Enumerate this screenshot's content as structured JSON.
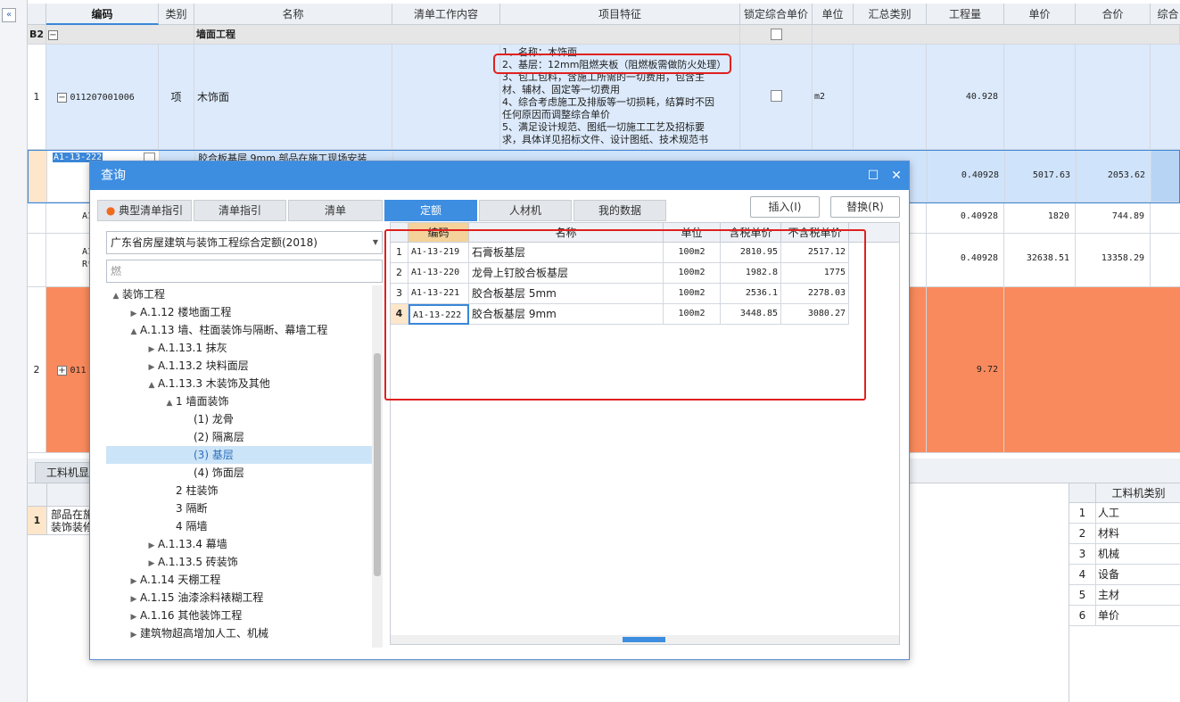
{
  "columns": [
    "编码",
    "类别",
    "名称",
    "清单工作内容",
    "项目特征",
    "锁定综合单价",
    "单位",
    "汇总类别",
    "工程量",
    "单价",
    "合价",
    "综合"
  ],
  "group": {
    "label": "B2",
    "name": "墙面工程"
  },
  "rows": [
    {
      "idx": "1",
      "code": "011207001006",
      "type": "项",
      "name": "木饰面",
      "unit": "m2",
      "qty": "40.928",
      "features": [
        "1、名称：木饰面",
        "2、基层：12mm阻燃夹板（阻燃板需做防火处理）",
        "3、包工包料，含施工所需的一切费用，包含主",
        "材、辅材、固定等一切费用",
        "4、综合考虑施工及排版等一切损耗，结算时不因",
        "任何原因而调整综合单价",
        "5、满足设计规范、图纸一切施工工艺及招标要",
        "求，具体详见招标文件、设计图纸、技术规范书"
      ]
    },
    {
      "idx": "",
      "code": "A1-13-222",
      "name": "胶合板基层 9mm  部品在施工现场安装",
      "qty": "0.40928",
      "price": "5017.63",
      "total": "2053.62"
    },
    {
      "idx": "",
      "code": "A1",
      "qty": "0.40928",
      "price": "1820",
      "total": "744.89"
    },
    {
      "idx": "",
      "code": "A1",
      "code2": "R*",
      "qty": "0.40928",
      "price": "32638.51",
      "total": "13358.29"
    },
    {
      "idx": "2",
      "code": "011",
      "qty": "9.72"
    }
  ],
  "bottom": {
    "tab": "工料机显",
    "row_idx": "1",
    "row_text1": "部品在施",
    "row_text2": "装饰装修",
    "category_header": "工料机类别",
    "categories": [
      {
        "n": "1",
        "v": "人工"
      },
      {
        "n": "2",
        "v": "材料"
      },
      {
        "n": "3",
        "v": "机械"
      },
      {
        "n": "4",
        "v": "设备"
      },
      {
        "n": "5",
        "v": "主材"
      },
      {
        "n": "6",
        "v": "单价"
      }
    ]
  },
  "dialog": {
    "title": "查询",
    "tabs": [
      "典型清单指引",
      "清单指引",
      "清单",
      "定额",
      "人材机",
      "我的数据"
    ],
    "insert_btn": "插入(I)",
    "replace_btn": "替换(R)",
    "library": "广东省房屋建筑与装饰工程综合定额(2018)",
    "search": "燃",
    "tree": [
      {
        "t": "装饰工程",
        "lvl": 0,
        "arr": "▲"
      },
      {
        "t": "A.1.12 楼地面工程",
        "lvl": 1,
        "arr": "▶"
      },
      {
        "t": "A.1.13 墙、柱面装饰与隔断、幕墙工程",
        "lvl": 1,
        "arr": "▲"
      },
      {
        "t": "A.1.13.1 抹灰",
        "lvl": 2,
        "arr": "▶"
      },
      {
        "t": "A.1.13.2 块料面层",
        "lvl": 2,
        "arr": "▶"
      },
      {
        "t": "A.1.13.3 木装饰及其他",
        "lvl": 2,
        "arr": "▲"
      },
      {
        "t": "1 墙面装饰",
        "lvl": 3,
        "arr": "▲"
      },
      {
        "t": "(1) 龙骨",
        "lvl": 4,
        "arr": ""
      },
      {
        "t": "(2) 隔离层",
        "lvl": 4,
        "arr": ""
      },
      {
        "t": "(3) 基层",
        "lvl": 4,
        "arr": "",
        "sel": true
      },
      {
        "t": "(4) 饰面层",
        "lvl": 4,
        "arr": ""
      },
      {
        "t": "2 柱装饰",
        "lvl": 3,
        "arr": ""
      },
      {
        "t": "3 隔断",
        "lvl": 3,
        "arr": ""
      },
      {
        "t": "4 隔墙",
        "lvl": 3,
        "arr": ""
      },
      {
        "t": "A.1.13.4 幕墙",
        "lvl": 2,
        "arr": "▶"
      },
      {
        "t": "A.1.13.5 砖装饰",
        "lvl": 2,
        "arr": "▶"
      },
      {
        "t": "A.1.14 天棚工程",
        "lvl": 1,
        "arr": "▶"
      },
      {
        "t": "A.1.15 油漆涂料裱糊工程",
        "lvl": 1,
        "arr": "▶"
      },
      {
        "t": "A.1.16 其他装饰工程",
        "lvl": 1,
        "arr": "▶"
      },
      {
        "t": "建筑物超高增加人工、机械",
        "lvl": 1,
        "arr": "▶"
      }
    ],
    "result_columns": [
      "",
      "编码",
      "名称",
      "单位",
      "含税单价",
      "不含税单价"
    ],
    "results": [
      {
        "n": "1",
        "code": "A1-13-219",
        "name": "石膏板基层",
        "unit": "100m2",
        "tax": "2810.95",
        "notax": "2517.12"
      },
      {
        "n": "2",
        "code": "A1-13-220",
        "name": "龙骨上钉胶合板基层",
        "unit": "100m2",
        "tax": "1982.8",
        "notax": "1775"
      },
      {
        "n": "3",
        "code": "A1-13-221",
        "name": "胶合板基层 5mm",
        "unit": "100m2",
        "tax": "2536.1",
        "notax": "2278.03"
      },
      {
        "n": "4",
        "code": "A1-13-222",
        "name": "胶合板基层 9mm",
        "unit": "100m2",
        "tax": "3448.85",
        "notax": "3080.27"
      }
    ]
  },
  "colors": {
    "accent": "#3d8de0",
    "highlight": "#f98a5d",
    "rowsel": "#dceafb",
    "annotation": "#e02020"
  }
}
